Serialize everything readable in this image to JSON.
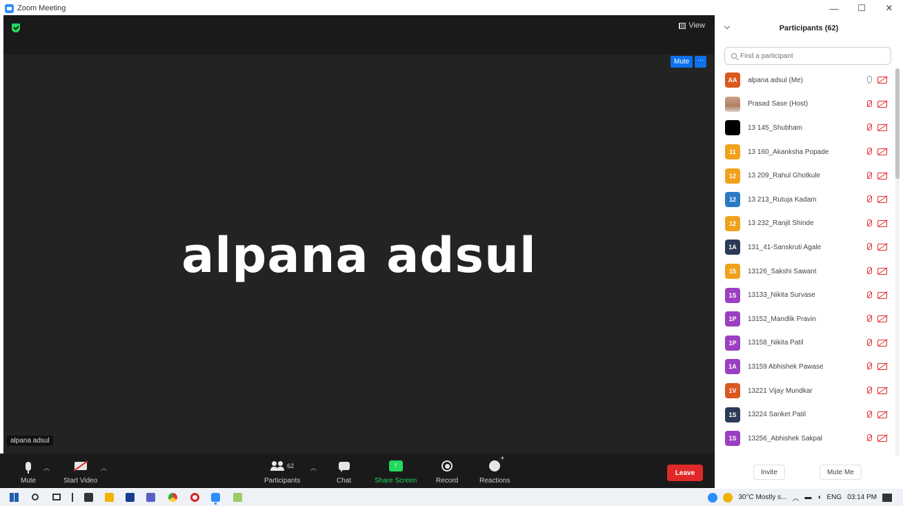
{
  "window": {
    "title": "Zoom Meeting",
    "controls": [
      "—",
      "☐",
      "✕"
    ]
  },
  "meeting": {
    "view_label": "View",
    "speaker_name": "alpana adsul",
    "tile_mute_label": "Mute",
    "tile_more_label": "···",
    "name_tag": "alpana adsul"
  },
  "toolbar": {
    "mute": "Mute",
    "start_video": "Start Video",
    "participants": "Participants",
    "participants_count": "62",
    "chat": "Chat",
    "share_screen": "Share Screen",
    "record": "Record",
    "reactions": "Reactions",
    "leave": "Leave"
  },
  "panel": {
    "title": "Participants (62)",
    "search_placeholder": "Find a participant",
    "invite": "Invite",
    "mute_me": "Mute Me",
    "participants": [
      {
        "initials": "AA",
        "color": "#d9581f",
        "name": "alpana adsul (Me)",
        "mic": "on",
        "photo": false
      },
      {
        "initials": "",
        "color": "#b07e64",
        "name": "Prasad Sase (Host)",
        "mic": "off",
        "photo": true
      },
      {
        "initials": "",
        "color": "#000000",
        "name": "13 145_Shubham",
        "mic": "off",
        "photo": false
      },
      {
        "initials": "11",
        "color": "#f0a21d",
        "name": "13 160_Akanksha Popade",
        "mic": "off",
        "photo": false
      },
      {
        "initials": "12",
        "color": "#f0a21d",
        "name": "13 209_Rahul Ghotkule",
        "mic": "off",
        "photo": false
      },
      {
        "initials": "12",
        "color": "#2a7bc4",
        "name": "13 213_Rutuja Kadam",
        "mic": "off",
        "photo": false
      },
      {
        "initials": "12",
        "color": "#f0a21d",
        "name": "13 232_Ranjit Shinde",
        "mic": "off",
        "photo": false
      },
      {
        "initials": "1A",
        "color": "#2b3a55",
        "name": "131_41-Sanskruti Agale",
        "mic": "off",
        "photo": false
      },
      {
        "initials": "15",
        "color": "#f0a21d",
        "name": "13126_Sakshi Sawant",
        "mic": "off",
        "photo": false
      },
      {
        "initials": "1S",
        "color": "#9b3fc1",
        "name": "13133_Nikita Survase",
        "mic": "off",
        "photo": false
      },
      {
        "initials": "1P",
        "color": "#9b3fc1",
        "name": "13152_Mandlik Pravin",
        "mic": "off",
        "photo": false
      },
      {
        "initials": "1P",
        "color": "#9b3fc1",
        "name": "13158_Nikita Patil",
        "mic": "off",
        "photo": false
      },
      {
        "initials": "1A",
        "color": "#9b3fc1",
        "name": "13159 Abhishek Pawase",
        "mic": "off",
        "photo": false
      },
      {
        "initials": "1V",
        "color": "#d9581f",
        "name": "13221 Vijay Mundkar",
        "mic": "off",
        "photo": false
      },
      {
        "initials": "1S",
        "color": "#2b3a55",
        "name": "13224 Sanket Patil",
        "mic": "off",
        "photo": false
      },
      {
        "initials": "1S",
        "color": "#9b3fc1",
        "name": "13256_Abhishek Sakpal",
        "mic": "off",
        "photo": false
      }
    ]
  },
  "taskbar": {
    "weather": "30°C Mostly s...",
    "language": "ENG",
    "time": "03:14 PM"
  }
}
